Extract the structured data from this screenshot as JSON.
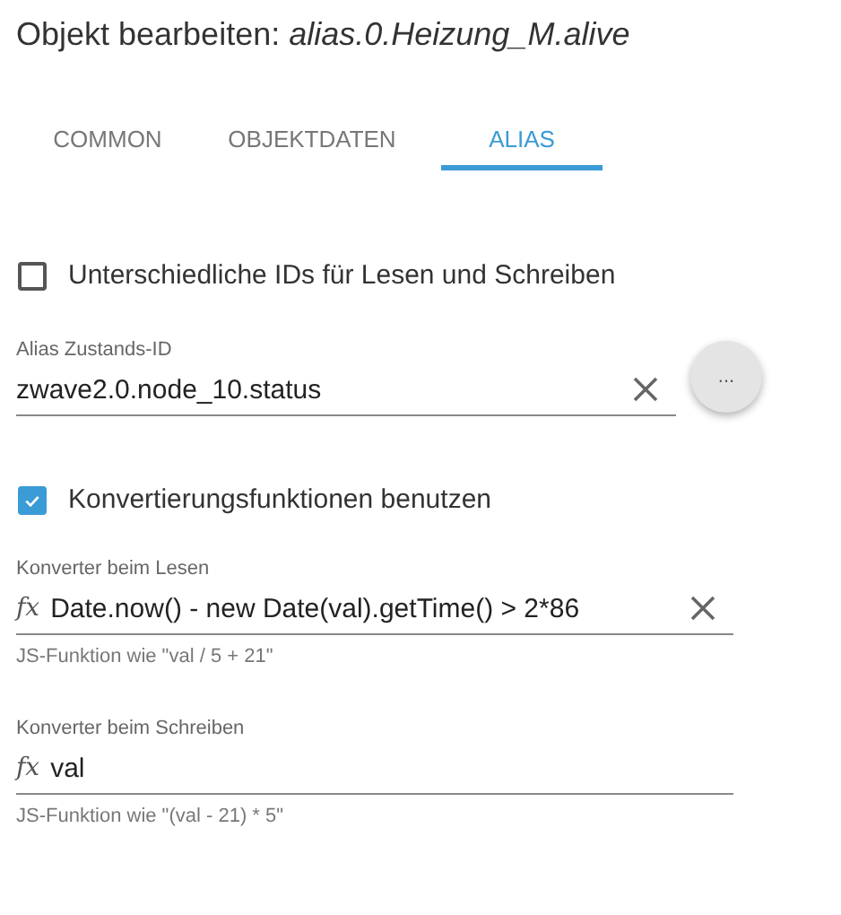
{
  "title": "Objekt bearbeiten: *alias.0.Heizung_M.alive*",
  "tabs": [
    {
      "label": "COMMON",
      "selected": false
    },
    {
      "label": "OBJEKTDATEN",
      "selected": false
    },
    {
      "label": "ALIAS",
      "selected": true
    }
  ],
  "separate_ids": {
    "label": "Unterschiedliche IDs für Lesen und Schreiben",
    "checked": false
  },
  "alias_id": {
    "label": "Alias Zustands-ID",
    "value": "zwave2.0.node_10.status",
    "clear_button": true,
    "browse_button": "..."
  },
  "use_converters": {
    "label": "Konvertierungsfunktionen benutzen",
    "checked": true
  },
  "converters": [
    {
      "label": "Konverter beim Lesen",
      "icon": "fx",
      "value": "Date.now() - new Date(val).getTime() > 2*86",
      "clear_button": true,
      "helper": "JS-Funktion wie \"val / 5 + 21\""
    },
    {
      "label": "Konverter beim Schreiben",
      "icon": "fx",
      "value": "val",
      "clear_button": false,
      "helper": "JS-Funktion wie \"(val - 21) * 5\""
    }
  ]
}
